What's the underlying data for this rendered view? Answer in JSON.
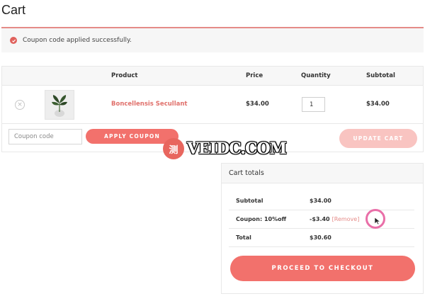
{
  "page": {
    "title": "Cart"
  },
  "notice": {
    "message": "Coupon code applied successfully."
  },
  "table": {
    "headers": {
      "product": "Product",
      "price": "Price",
      "quantity": "Quantity",
      "subtotal": "Subtotal"
    },
    "rows": [
      {
        "name": "Boncellensis Secullant",
        "price": "$34.00",
        "quantity": "1",
        "subtotal": "$34.00"
      }
    ],
    "coupon_placeholder": "Coupon code",
    "apply_label": "APPLY COUPON",
    "update_label": "UPDATE CART"
  },
  "totals": {
    "title": "Cart totals",
    "rows": [
      {
        "label": "Subtotal",
        "value": "$34.00"
      },
      {
        "label": "Coupon: 10%off",
        "value": "-$3.40",
        "link": "[Remove]"
      },
      {
        "label": "Total",
        "value": "$30.60"
      }
    ],
    "checkout_label": "PROCEED TO CHECKOUT"
  },
  "watermark": {
    "badge": "测",
    "text": "VEIDC.COM"
  },
  "colors": {
    "accent": "#f2716c",
    "accent_light": "#f9c4c1",
    "link": "#e0706b",
    "notice_border": "#e58b88"
  },
  "icons": {
    "notice": "check-circle-icon",
    "remove_item": "close-circle-icon",
    "cursor": "mouse-pointer-icon"
  }
}
